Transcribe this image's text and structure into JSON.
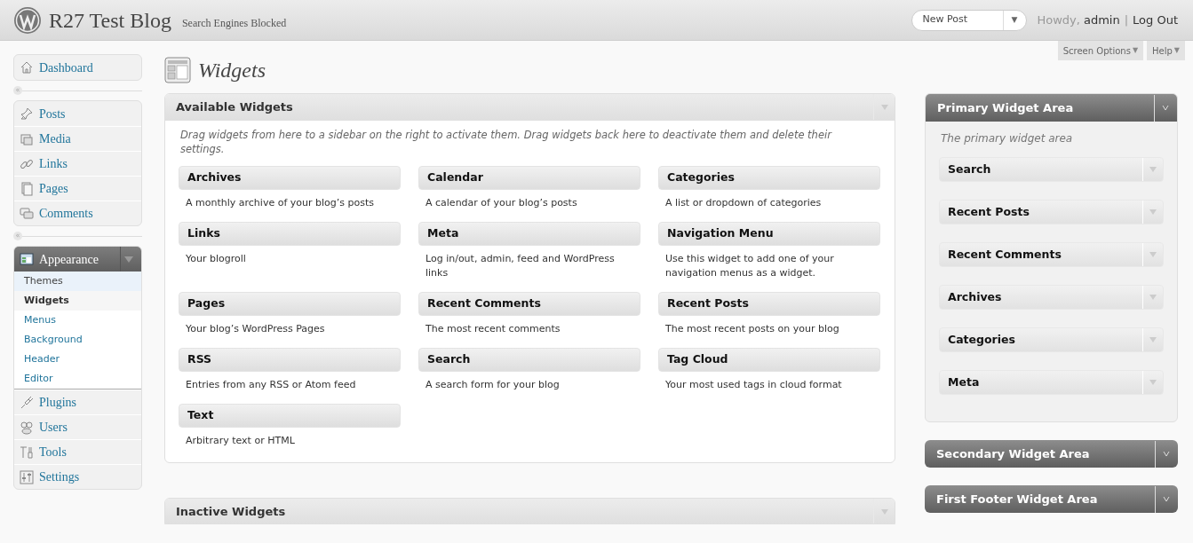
{
  "header": {
    "site_title": "R27 Test Blog",
    "site_note": "Search Engines Blocked",
    "favorite_action": {
      "label": "New Post",
      "toggle": "▼"
    },
    "greeting": "Howdy,",
    "user": "admin",
    "separator": "|",
    "logout": "Log Out"
  },
  "screen_meta": [
    {
      "label": "Screen Options",
      "arrow": "▼"
    },
    {
      "label": "Help",
      "arrow": "▼"
    }
  ],
  "menu": [
    {
      "kind": "group",
      "items": [
        {
          "label": "Dashboard",
          "selected": false
        }
      ]
    },
    {
      "kind": "separator",
      "glyph": "«"
    },
    {
      "kind": "group",
      "items": [
        {
          "label": "Posts",
          "selected": false
        },
        {
          "label": "Media",
          "selected": false
        },
        {
          "label": "Links",
          "selected": false
        },
        {
          "label": "Pages",
          "selected": false
        },
        {
          "label": "Comments",
          "selected": false
        }
      ]
    },
    {
      "kind": "separator",
      "glyph": "«"
    },
    {
      "kind": "group",
      "items": [
        {
          "label": "Appearance",
          "selected": true,
          "expanded": true,
          "children": [
            {
              "label": "Themes",
              "selected": false,
              "highlighted": true
            },
            {
              "label": "Widgets",
              "selected": true,
              "highlighted": false
            },
            {
              "label": "Menus",
              "selected": false,
              "highlighted": false
            },
            {
              "label": "Background",
              "selected": false,
              "highlighted": false
            },
            {
              "label": "Header",
              "selected": false,
              "highlighted": false
            },
            {
              "label": "Editor",
              "selected": false,
              "highlighted": false
            }
          ]
        },
        {
          "label": "Plugins",
          "selected": false
        },
        {
          "label": "Users",
          "selected": false
        },
        {
          "label": "Tools",
          "selected": false
        },
        {
          "label": "Settings",
          "selected": false
        }
      ]
    }
  ],
  "page_title": "Widgets",
  "available_widgets": {
    "title": "Available Widgets",
    "description": "Drag widgets from here to a sidebar on the right to activate them. Drag widgets back here to deactivate them and delete their settings.",
    "widgets": [
      {
        "title": "Archives",
        "description": "A monthly archive of your blog’s posts"
      },
      {
        "title": "Calendar",
        "description": "A calendar of your blog’s posts"
      },
      {
        "title": "Categories",
        "description": "A list or dropdown of categories"
      },
      {
        "title": "Links",
        "description": "Your blogroll"
      },
      {
        "title": "Meta",
        "description": "Log in/out, admin, feed and WordPress links"
      },
      {
        "title": "Navigation Menu",
        "description": "Use this widget to add one of your navigation menus as a widget."
      },
      {
        "title": "Pages",
        "description": "Your blog’s WordPress Pages"
      },
      {
        "title": "Recent Comments",
        "description": "The most recent comments"
      },
      {
        "title": "Recent Posts",
        "description": "The most recent posts on your blog"
      },
      {
        "title": "RSS",
        "description": "Entries from any RSS or Atom feed"
      },
      {
        "title": "Search",
        "description": "A search form for your blog"
      },
      {
        "title": "Tag Cloud",
        "description": "Your most used tags in cloud format"
      },
      {
        "title": "Text",
        "description": "Arbitrary text or HTML"
      }
    ]
  },
  "inactive_widgets": {
    "title": "Inactive Widgets"
  },
  "sidebars": [
    {
      "title": "Primary Widget Area",
      "expanded": true,
      "description": "The primary widget area",
      "widgets": [
        {
          "title": "Search"
        },
        {
          "title": "Recent Posts"
        },
        {
          "title": "Recent Comments"
        },
        {
          "title": "Archives"
        },
        {
          "title": "Categories"
        },
        {
          "title": "Meta"
        }
      ]
    },
    {
      "title": "Secondary Widget Area",
      "expanded": false
    },
    {
      "title": "First Footer Widget Area",
      "expanded": false
    }
  ]
}
